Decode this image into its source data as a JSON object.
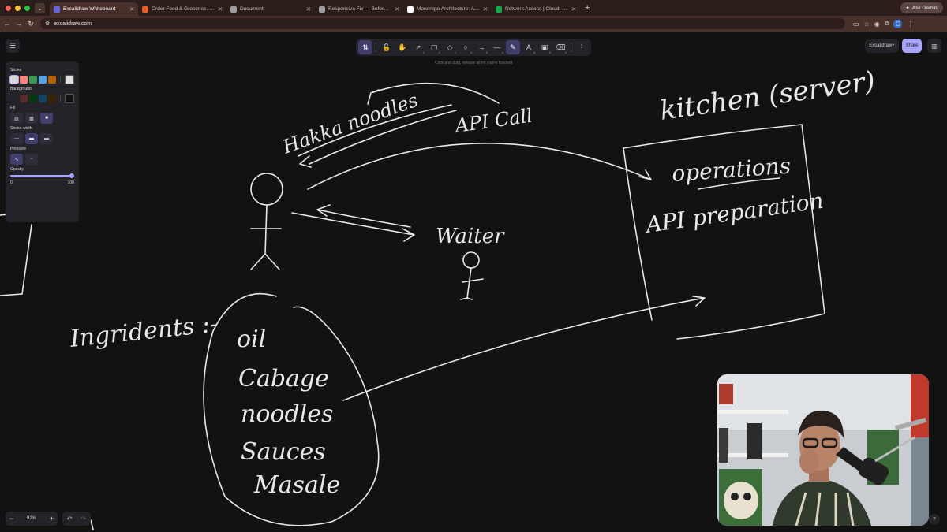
{
  "browser": {
    "tabs": [
      {
        "title": "Excalidraw Whiteboard",
        "active": true,
        "color": "#6965db"
      },
      {
        "title": "Order Food & Groceries. Disc",
        "active": false,
        "color": "#e8612c"
      },
      {
        "title": "Document",
        "active": false,
        "color": "#9e9e9e"
      },
      {
        "title": "Responsive Fix — Before vs A",
        "active": false,
        "color": "#9e9e9e"
      },
      {
        "title": "Monorepo Architecture: A Cr",
        "active": false,
        "color": "#ffffff"
      },
      {
        "title": "Network Access | Cloud: Mo",
        "active": false,
        "color": "#13aa52"
      }
    ],
    "ask_gemini": "Ask Gemini",
    "url": "excalidraw.com",
    "profile_initial": "G"
  },
  "toolbar": {
    "hint": "Click and drag, release when you're finished",
    "tools": [
      {
        "name": "lock-tool",
        "glyph": "🔓",
        "key": ""
      },
      {
        "name": "hand-tool",
        "glyph": "✋",
        "key": ""
      },
      {
        "name": "selection-tool",
        "glyph": "➚",
        "key": "1"
      },
      {
        "name": "rectangle-tool",
        "glyph": "▢",
        "key": "2"
      },
      {
        "name": "diamond-tool",
        "glyph": "◇",
        "key": "3"
      },
      {
        "name": "ellipse-tool",
        "glyph": "○",
        "key": "4"
      },
      {
        "name": "arrow-tool",
        "glyph": "→",
        "key": "5"
      },
      {
        "name": "line-tool",
        "glyph": "—",
        "key": "6"
      },
      {
        "name": "draw-tool",
        "glyph": "✎",
        "key": "7",
        "active": true
      },
      {
        "name": "text-tool",
        "glyph": "A",
        "key": "8"
      },
      {
        "name": "image-tool",
        "glyph": "▣",
        "key": "9"
      },
      {
        "name": "eraser-tool",
        "glyph": "⌫",
        "key": "0"
      }
    ],
    "excalidraw_plus": "Excalidraw+",
    "share": "Share"
  },
  "properties": {
    "stroke_label": "Stroke",
    "stroke_colors": [
      "#d8d8d8",
      "#ff8383",
      "#3a994c",
      "#56a2e8",
      "#b76100"
    ],
    "stroke_current": "#e0e0e0",
    "background_label": "Background",
    "background_colors": [
      "#232329",
      "#5b2c2c",
      "#043b0c",
      "#154163",
      "#362500"
    ],
    "background_current": "#121212",
    "fill_label": "Fill",
    "stroke_width_label": "Stroke width",
    "pressure_label": "Pressure",
    "opacity_label": "Opacity",
    "opacity_min": "0",
    "opacity_max": "100",
    "opacity_value": 1.0
  },
  "footer": {
    "zoom": "92%"
  },
  "drawing_texts": {
    "hakka": "Hakka noodles",
    "api_call": "API Call",
    "kitchen": "kitchen (server)",
    "operations": "operations",
    "api_prep": "API preparation",
    "waiter": "Waiter",
    "ingredients": "Ingridents :-",
    "oil": "oil",
    "cabbage": "Cabage",
    "noodles": "noodles",
    "sauces": "Sauces",
    "masala": "Masale"
  }
}
